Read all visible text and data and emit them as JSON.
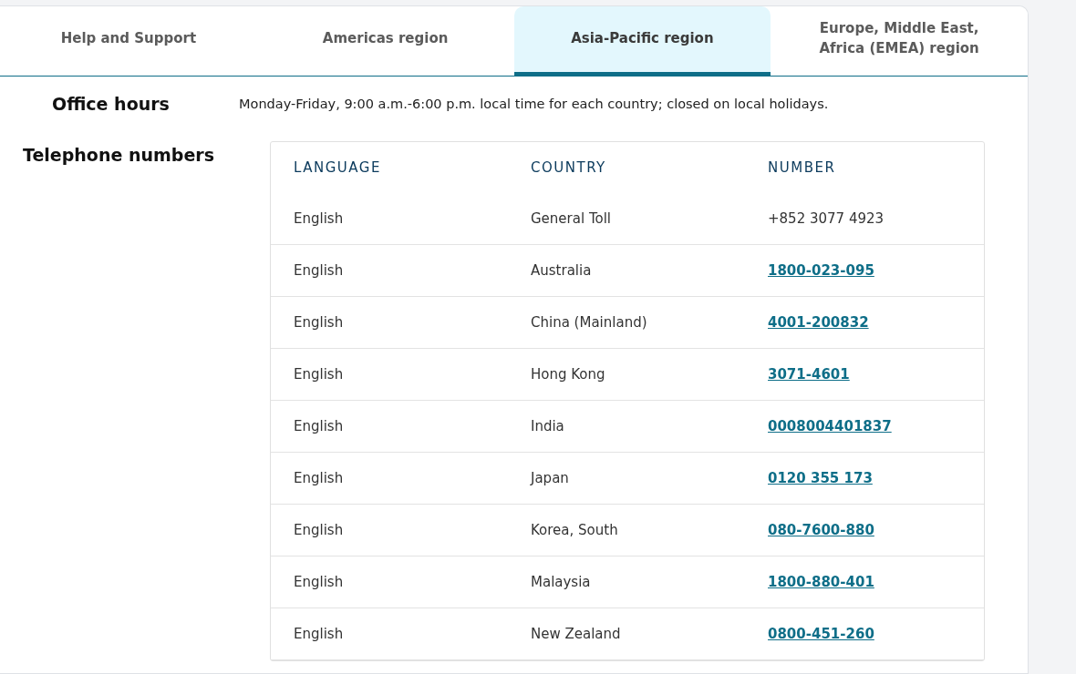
{
  "tabs": [
    {
      "label": "Help and Support",
      "selected": false
    },
    {
      "label": "Americas region",
      "selected": false
    },
    {
      "label": "Asia-Pacific region",
      "selected": true
    },
    {
      "label": "Europe, Middle East, Africa (EMEA) region",
      "selected": false
    }
  ],
  "office_hours": {
    "label": "Office hours",
    "text": "Monday-Friday, 9:00 a.m.-6:00 p.m. local time for each country; closed on local holidays."
  },
  "telephone": {
    "label": "Telephone numbers",
    "table": {
      "columns": [
        "LANGUAGE",
        "COUNTRY",
        "NUMBER"
      ],
      "rows": [
        {
          "language": "English",
          "country": "General Toll",
          "number": "+852 3077 4923",
          "link": false
        },
        {
          "language": "English",
          "country": "Australia",
          "number": "1800-023-095",
          "link": true
        },
        {
          "language": "English",
          "country": "China (Mainland)",
          "number": "4001-200832",
          "link": true
        },
        {
          "language": "English",
          "country": "Hong Kong",
          "number": "3071-4601",
          "link": true
        },
        {
          "language": "English",
          "country": "India",
          "number": "0008004401837",
          "link": true
        },
        {
          "language": "English",
          "country": "Japan",
          "number": "0120 355 173",
          "link": true
        },
        {
          "language": "English",
          "country": "Korea, South",
          "number": "080-7600-880",
          "link": true
        },
        {
          "language": "English",
          "country": "Malaysia",
          "number": "1800-880-401",
          "link": true
        },
        {
          "language": "English",
          "country": "New Zealand",
          "number": "0800-451-260",
          "link": true
        }
      ]
    }
  }
}
